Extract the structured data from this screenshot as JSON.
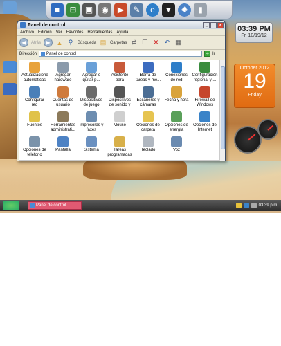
{
  "window": {
    "title": "Panel de control",
    "menu": [
      "Archivo",
      "Edición",
      "Ver",
      "Favoritos",
      "Herramientas",
      "Ayuda"
    ],
    "toolbar": {
      "back": "Atrás",
      "search": "Búsqueda",
      "folders": "Carpetas"
    },
    "address_label": "Dirección",
    "address_value": "Panel de control",
    "go": "Ir"
  },
  "items": [
    {
      "label": "Actualizaciones automáticas",
      "color": "#e8a23c"
    },
    {
      "label": "Agregar hardware",
      "color": "#8a9aab"
    },
    {
      "label": "Agregar o quitar p...",
      "color": "#6aa0d8"
    },
    {
      "label": "Asistente para configuració...",
      "color": "#c85a3a"
    },
    {
      "label": "Barra de tareas y me...",
      "color": "#3c6cc0"
    },
    {
      "label": "Conexiones de red",
      "color": "#2e7ec9"
    },
    {
      "label": "Configuración regional y ...",
      "color": "#3a8c3e"
    },
    {
      "label": "Configurar red inalámbrica",
      "color": "#4a7fb8"
    },
    {
      "label": "Cuentas de usuario",
      "color": "#cf7a3c"
    },
    {
      "label": "Dispositivos de juego",
      "color": "#6b6b6b"
    },
    {
      "label": "Dispositivos de sonido y audio",
      "color": "#555"
    },
    {
      "label": "Escáneres y cámaras",
      "color": "#4b6d94"
    },
    {
      "label": "Fecha y hora",
      "color": "#d9a33c"
    },
    {
      "label": "Firewall de Windows",
      "color": "#c6462c"
    },
    {
      "label": "Fuentes",
      "color": "#e0c24a"
    },
    {
      "label": "Herramientas administrati...",
      "color": "#8c7a5a"
    },
    {
      "label": "Impresoras y faxes",
      "color": "#6d8db0"
    },
    {
      "label": "Mouse",
      "color": "#cfcfcf"
    },
    {
      "label": "Opciones de carpeta",
      "color": "#e6c450"
    },
    {
      "label": "Opciones de energía",
      "color": "#5aa05a"
    },
    {
      "label": "Opciones de Internet",
      "color": "#3a83c8"
    },
    {
      "label": "Opciones de teléfono",
      "color": "#7b93aa"
    },
    {
      "label": "Pantalla",
      "color": "#4d82c4"
    },
    {
      "label": "Sistema",
      "color": "#6a90c0"
    },
    {
      "label": "Tareas programadas",
      "color": "#d8b04a"
    },
    {
      "label": "Teclado",
      "color": "#b0b7c0"
    },
    {
      "label": "Voz",
      "color": "#6a8ab0"
    }
  ],
  "clock": {
    "time": "03:39 PM",
    "date": "Fri 10/19/12"
  },
  "calendar": {
    "month": "October 2012",
    "day": "19",
    "weekday": "Friday"
  },
  "taskbar": {
    "task": "Panel de control",
    "time": "03:39 p.m."
  }
}
